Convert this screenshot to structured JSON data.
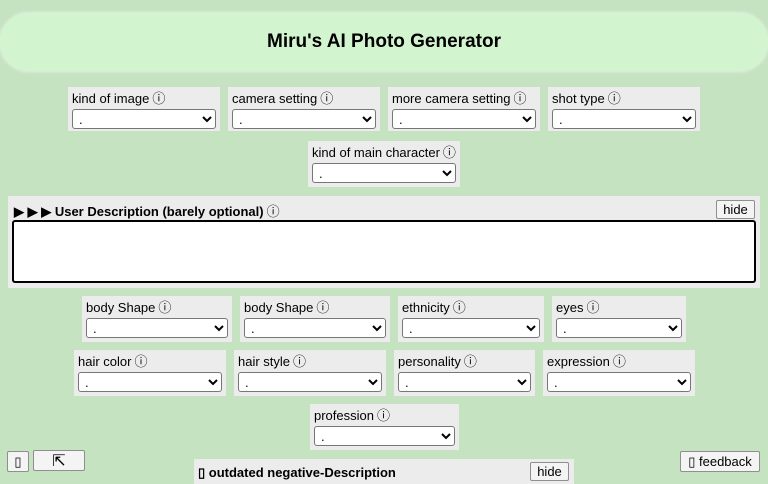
{
  "header": {
    "title": "Miru's AI Photo Generator"
  },
  "info_glyph": "ⓘ",
  "dropdowns": {
    "kind_of_image": {
      "label": "kind of image",
      "value": "."
    },
    "camera_setting": {
      "label": "camera setting",
      "value": "."
    },
    "more_camera_setting": {
      "label": "more camera setting",
      "value": "."
    },
    "shot_type": {
      "label": "shot type",
      "value": "."
    },
    "kind_of_main_character": {
      "label": "kind of main character",
      "value": "."
    },
    "body_shape_1": {
      "label": "body Shape",
      "value": "."
    },
    "body_shape_2": {
      "label": "body Shape",
      "value": "."
    },
    "ethnicity": {
      "label": "ethnicity",
      "value": "."
    },
    "eyes": {
      "label": "eyes",
      "value": "."
    },
    "hair_color": {
      "label": "hair color",
      "value": "."
    },
    "hair_style": {
      "label": "hair style",
      "value": "."
    },
    "personality": {
      "label": "personality",
      "value": "."
    },
    "expression": {
      "label": "expression",
      "value": "."
    },
    "profession": {
      "label": "profession",
      "value": "."
    }
  },
  "user_description": {
    "title": "▶ ▶ ▶ User Description (barely optional)",
    "hide_label": "hide",
    "value": ""
  },
  "negative_description": {
    "title": "▯ outdated negative-Description",
    "hide_label": "hide"
  },
  "bottom_left": {
    "button1_label": "▯",
    "button2_label": "⇱"
  },
  "feedback": {
    "label": "▯ feedback"
  }
}
